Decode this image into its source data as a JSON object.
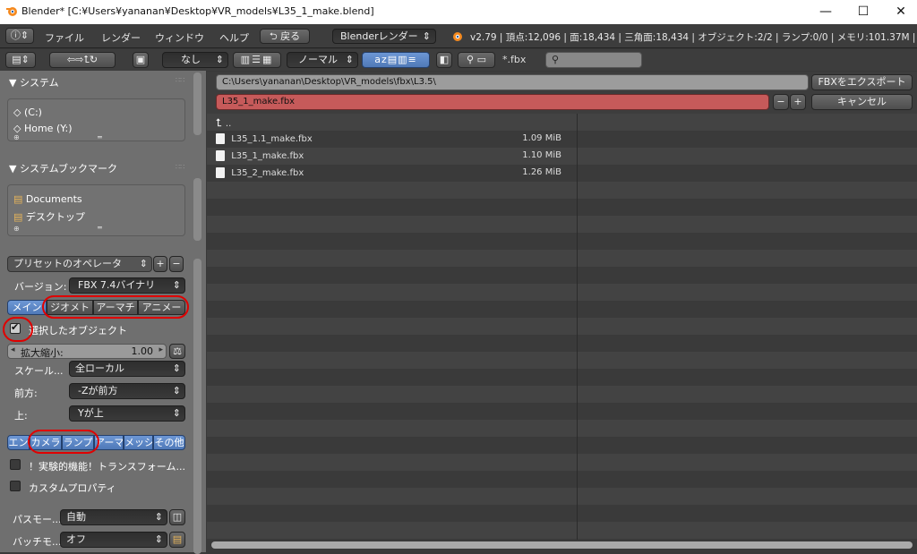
{
  "window": {
    "title": "Blender* [C:¥Users¥yananan¥Desktop¥VR_models¥L35_1_make.blend]",
    "min": "—",
    "max": "☐",
    "close": "✕"
  },
  "menu": {
    "file": "ファイル",
    "render": "レンダー",
    "window": "ウィンドウ",
    "help": "ヘルプ",
    "back": "戻る",
    "engine": "Blenderレンダー",
    "stats": "v2.79 | 頂点:12,096 | 面:18,434 | 三角面:18,434 | オブジェクト:2/2 | ランプ:0/0 | メモリ:101.37M | Ar"
  },
  "toolbar": {
    "filter_none": "なし",
    "sort": "ノーマル",
    "filter_ext": "*.fbx",
    "search_placeholder": ""
  },
  "sidebar": {
    "system_header": "▼ システム",
    "system_items": [
      "(C:)",
      "Home (Y:)"
    ],
    "bookmarks_header": "▼ システムブックマーク",
    "bookmark_items": [
      "Documents",
      "デスクトップ"
    ]
  },
  "operator": {
    "preset": "プリセットのオペレータ",
    "version_label": "バージョン:",
    "version_value": "FBX 7.4バイナリ",
    "tabs": [
      "メイン",
      "ジオメト",
      "アーマチ",
      "アニメー"
    ],
    "selected_objects": "選択したオブジェクト",
    "scale_label": "拡大縮小:",
    "scale_value": "1.00",
    "apply_scale_label": "スケール...",
    "apply_scale_value": "全ローカル",
    "forward_label": "前方:",
    "forward_value": "-Zが前方",
    "up_label": "上:",
    "up_value": "Yが上",
    "type_tabs": [
      "エン",
      "カメラ",
      "ランプ",
      "アーマ",
      "メッシ",
      "その他"
    ],
    "experimental": "！実験的機能！トランスフォーム...",
    "custom_props": "カスタムプロパティ",
    "path_mode_label": "パスモー...",
    "path_mode_value": "自動",
    "batch_mode_label": "バッチモ...",
    "batch_mode_value": "オフ"
  },
  "browser": {
    "directory": "C:\\Users\\yananan\\Desktop\\VR_models\\fbx\\L3.5\\",
    "filename": "L35_1_make.fbx",
    "export_button": "FBXをエクスポート",
    "cancel_button": "キャンセル",
    "parent": "..",
    "files": [
      {
        "name": "L35_1.1_make.fbx",
        "size": "1.09 MiB"
      },
      {
        "name": "L35_1_make.fbx",
        "size": "1.10 MiB"
      },
      {
        "name": "L35_2_make.fbx",
        "size": "1.26 MiB"
      }
    ]
  },
  "colors": {
    "accent": "#5680c2",
    "filename_bg": "#c65a5a",
    "annotation": "#e00000"
  }
}
